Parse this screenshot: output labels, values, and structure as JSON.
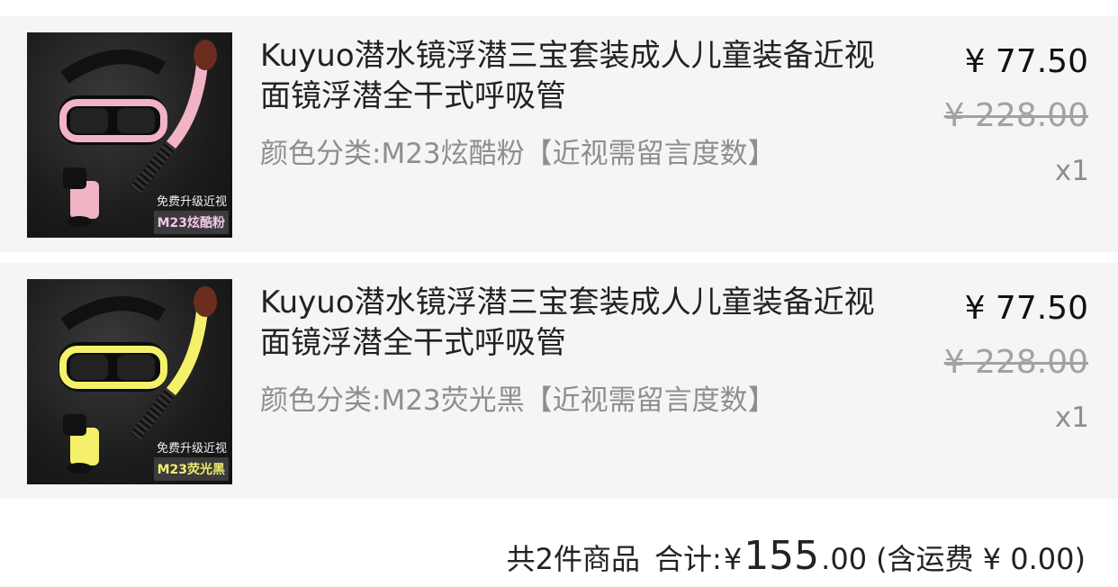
{
  "items": [
    {
      "title": "Kuyuo潜水镜浮潜三宝套装成人儿童装备近视面镜浮潜全干式呼吸管",
      "variant": "颜色分类:M23炫酷粉【近视需留言度数】",
      "price": "¥ 77.50",
      "original_price": "¥ 228.00",
      "quantity": "x1",
      "image_badge_top": "免费升级近视",
      "image_badge_bottom": "M23炫酷粉",
      "accent_color": "#f2b3c4"
    },
    {
      "title": "Kuyuo潜水镜浮潜三宝套装成人儿童装备近视面镜浮潜全干式呼吸管",
      "variant": "颜色分类:M23荧光黑【近视需留言度数】",
      "price": "¥ 77.50",
      "original_price": "¥ 228.00",
      "quantity": "x1",
      "image_badge_top": "免费升级近视",
      "image_badge_bottom": "M23荧光黑",
      "accent_color": "#f5f06a"
    }
  ],
  "summary": {
    "count_text": "共2件商品",
    "total_label": "合计:",
    "currency": "¥",
    "total_integer": "155",
    "total_decimal": ".00",
    "shipping_text": "(含运费 ¥ 0.00)"
  }
}
